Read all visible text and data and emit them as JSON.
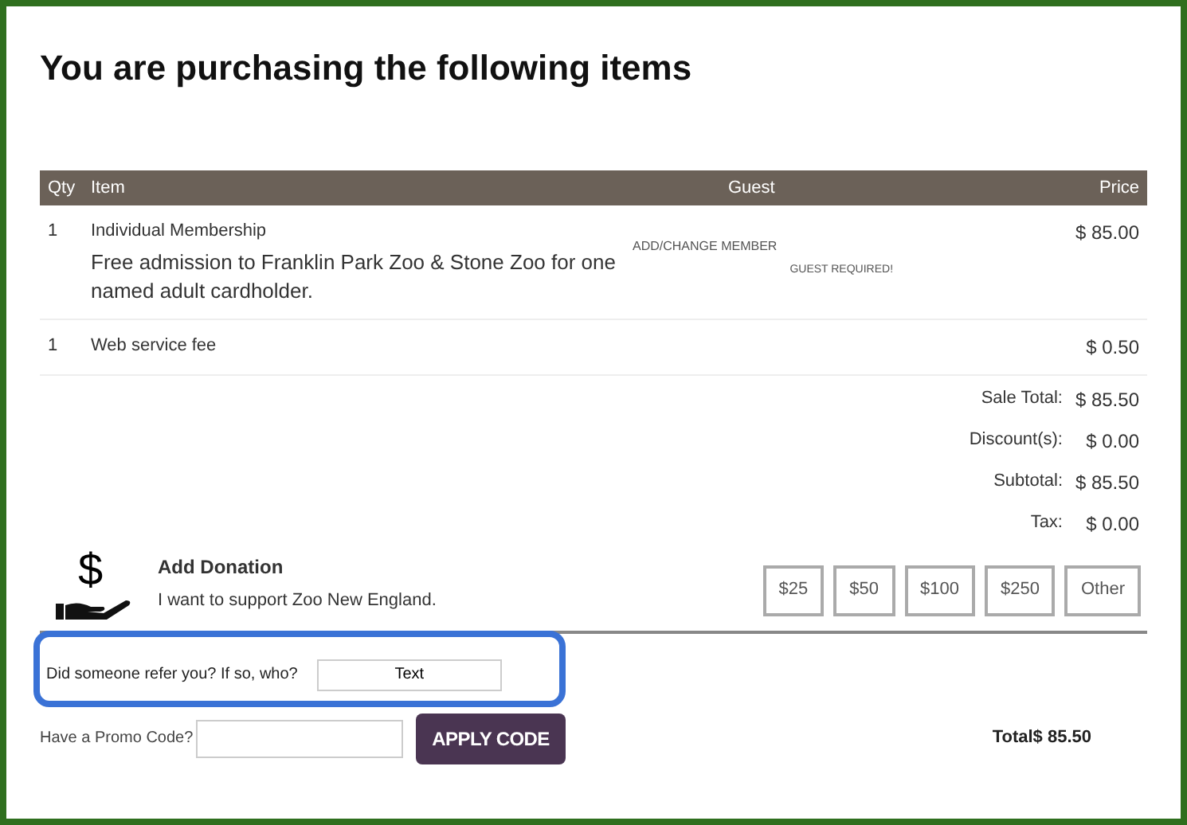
{
  "title": "You are purchasing the following items",
  "table": {
    "columns": [
      "Qty",
      "Item",
      "Guest",
      "Price"
    ],
    "rows": [
      {
        "qty": "1",
        "item": "Individual Membership",
        "description": "Free admission to Franklin Park Zoo & Stone Zoo for one named adult cardholder.",
        "guest_link": "ADD/CHANGE MEMBER",
        "guest_note": "GUEST REQUIRED!",
        "price": "$ 85.00"
      },
      {
        "qty": "1",
        "item": "Web service fee",
        "price": "$ 0.50"
      }
    ]
  },
  "summary": [
    {
      "label": "Sale Total:",
      "value": "$ 85.50"
    },
    {
      "label": "Discount(s):",
      "value": "$ 0.00"
    },
    {
      "label": "Subtotal:",
      "value": "$ 85.50"
    },
    {
      "label": "Tax:",
      "value": "$ 0.00"
    }
  ],
  "donation": {
    "icon_char": "$",
    "title": "Add Donation",
    "text": "I want to support Zoo New England.",
    "amounts": [
      "$25",
      "$50",
      "$100",
      "$250",
      "Other"
    ]
  },
  "referral": {
    "label": "Did someone refer you? If so, who?",
    "value": "Text",
    "highlighted": true
  },
  "promo": {
    "label": "Have a Promo Code?",
    "button": "APPLY CODE"
  },
  "total": {
    "label": "Total",
    "value": "$ 85.50"
  }
}
